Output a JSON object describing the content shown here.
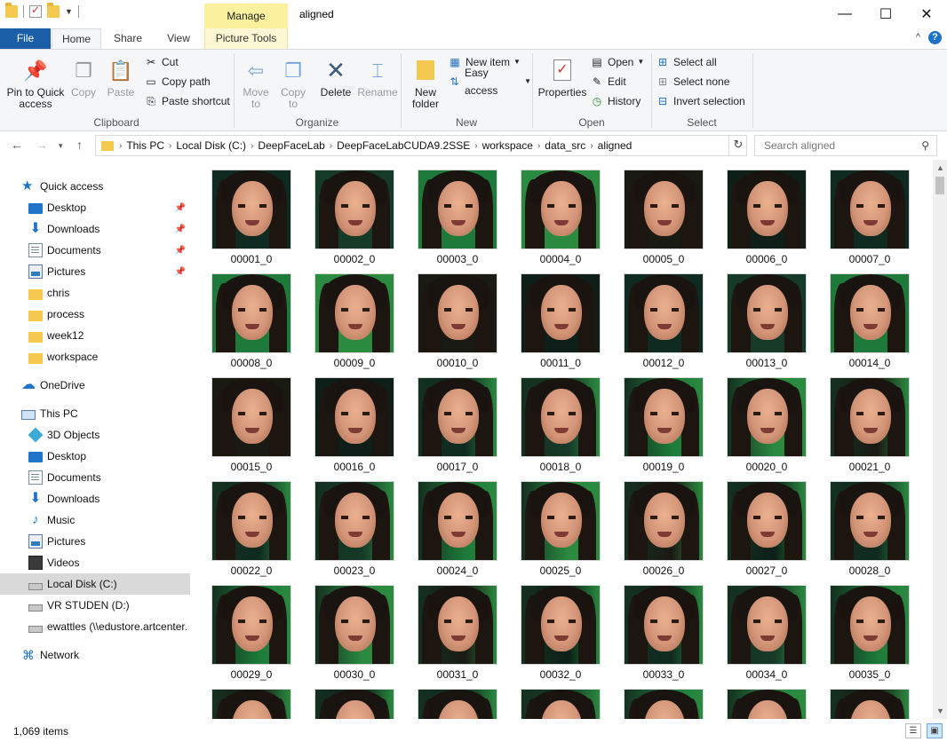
{
  "window": {
    "title": "aligned",
    "context_tab": "Manage"
  },
  "tabs": {
    "file": "File",
    "home": "Home",
    "share": "Share",
    "view": "View",
    "picture_tools": "Picture Tools"
  },
  "ribbon": {
    "clipboard": {
      "label": "Clipboard",
      "pin": "Pin to Quick access",
      "copy": "Copy",
      "paste": "Paste",
      "cut": "Cut",
      "copy_path": "Copy path",
      "paste_shortcut": "Paste shortcut"
    },
    "organize": {
      "label": "Organize",
      "move_to": "Move to",
      "copy_to": "Copy to",
      "delete": "Delete",
      "rename": "Rename"
    },
    "new": {
      "label": "New",
      "new_folder": "New folder",
      "new_item": "New item",
      "easy_access": "Easy access"
    },
    "open": {
      "label": "Open",
      "properties": "Properties",
      "open": "Open",
      "edit": "Edit",
      "history": "History"
    },
    "select": {
      "label": "Select",
      "select_all": "Select all",
      "select_none": "Select none",
      "invert": "Invert selection"
    }
  },
  "breadcrumb": [
    "This PC",
    "Local Disk (C:)",
    "DeepFaceLab",
    "DeepFaceLabCUDA9.2SSE",
    "workspace",
    "data_src",
    "aligned"
  ],
  "search": {
    "placeholder": "Search aligned"
  },
  "nav": {
    "quick_access": "Quick access",
    "quick": [
      "Desktop",
      "Downloads",
      "Documents",
      "Pictures",
      "chris",
      "process",
      "week12",
      "workspace"
    ],
    "onedrive": "OneDrive",
    "this_pc": "This PC",
    "pc": [
      "3D Objects",
      "Desktop",
      "Documents",
      "Downloads",
      "Music",
      "Pictures",
      "Videos",
      "Local Disk (C:)",
      "VR STUDEN (D:)",
      "ewattles (\\\\edustore.artcenter."
    ],
    "network": "Network"
  },
  "files": [
    "00001_0",
    "00002_0",
    "00003_0",
    "00004_0",
    "00005_0",
    "00006_0",
    "00007_0",
    "00008_0",
    "00009_0",
    "00010_0",
    "00011_0",
    "00012_0",
    "00013_0",
    "00014_0",
    "00015_0",
    "00016_0",
    "00017_0",
    "00018_0",
    "00019_0",
    "00020_0",
    "00021_0",
    "00022_0",
    "00023_0",
    "00024_0",
    "00025_0",
    "00026_0",
    "00027_0",
    "00028_0",
    "00029_0",
    "00030_0",
    "00031_0",
    "00032_0",
    "00033_0",
    "00034_0",
    "00035_0",
    "",
    "",
    "",
    "",
    "",
    "",
    ""
  ],
  "status": {
    "count": "1,069 items"
  },
  "colors": {
    "accent": "#1a5ea7",
    "manage": "#faf09e",
    "selected": "#cce8ff"
  }
}
